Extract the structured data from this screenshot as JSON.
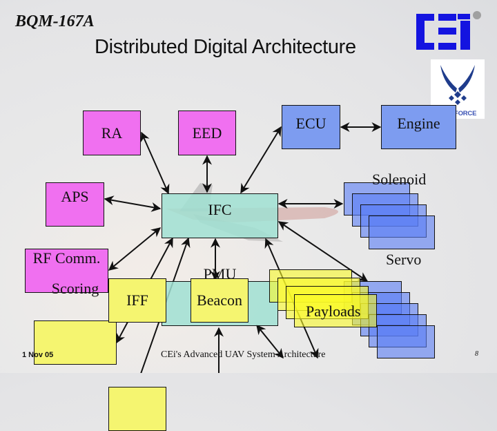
{
  "header": {
    "subtitle": "BQM-167A",
    "title": "Distributed Digital Architecture"
  },
  "logos": {
    "company": {
      "icon": "cei-logo",
      "color": "#1414e0",
      "dot_color": "#a0a0a0"
    },
    "air_force": {
      "icon": "usaf-wings-logo",
      "text": "U.S. AIR FORCE",
      "color": "#1f3c8c"
    }
  },
  "colors": {
    "sensor_box": "#f070f0",
    "core_box": "#a0e1d2",
    "propulsion_box": "#7d9cf0",
    "payload_box": "#f5f570",
    "arrow": "#111111"
  },
  "nodes": {
    "ra": {
      "label": "RA",
      "group": "magenta"
    },
    "eed": {
      "label": "EED",
      "group": "magenta"
    },
    "aps": {
      "label": "APS",
      "group": "magenta"
    },
    "rf_comm": {
      "label": "RF Comm.",
      "group": "magenta"
    },
    "ifc": {
      "label": "IFC",
      "group": "teal"
    },
    "pmu": {
      "label": "PMU",
      "group": "teal"
    },
    "ecu": {
      "label": "ECU",
      "group": "blue"
    },
    "engine": {
      "label": "Engine",
      "group": "blue"
    },
    "solenoid": {
      "label": "Solenoid",
      "group": "blue",
      "stacked": true,
      "stack_count": 4
    },
    "servo": {
      "label": "Servo",
      "group": "blue",
      "stacked": true,
      "stack_count": 5
    },
    "scoring": {
      "label": "Scoring",
      "group": "yellow"
    },
    "iff": {
      "label": "IFF",
      "group": "yellow"
    },
    "beacon": {
      "label": "Beacon",
      "group": "yellow"
    },
    "payloads": {
      "label": "Payloads",
      "group": "yellow",
      "stacked": true,
      "stack_count": 4
    }
  },
  "edges": [
    {
      "from": "ra",
      "to": "ifc",
      "type": "bidirectional"
    },
    {
      "from": "eed",
      "to": "ifc",
      "type": "bidirectional"
    },
    {
      "from": "ecu",
      "to": "ifc",
      "type": "bidirectional"
    },
    {
      "from": "ecu",
      "to": "engine",
      "type": "bidirectional"
    },
    {
      "from": "aps",
      "to": "ifc",
      "type": "bidirectional"
    },
    {
      "from": "rf_comm",
      "to": "ifc",
      "type": "bidirectional"
    },
    {
      "from": "solenoid",
      "to": "ifc",
      "type": "bidirectional"
    },
    {
      "from": "servo",
      "to": "ifc",
      "type": "bidirectional"
    },
    {
      "from": "pmu",
      "to": "ifc",
      "type": "bidirectional"
    },
    {
      "from": "scoring",
      "to": "ifc",
      "type": "bidirectional"
    },
    {
      "from": "iff",
      "to": "ifc",
      "type": "bidirectional"
    },
    {
      "from": "payloads",
      "to": "ifc",
      "type": "bidirectional"
    },
    {
      "from": "beacon",
      "to": "pmu",
      "type": "bidirectional"
    },
    {
      "from": "payloads",
      "to": "pmu",
      "type": "bidirectional"
    }
  ],
  "footer": {
    "date": "1 Nov 05",
    "center": "CEi's Advanced UAV System Architecture",
    "page": "8"
  }
}
